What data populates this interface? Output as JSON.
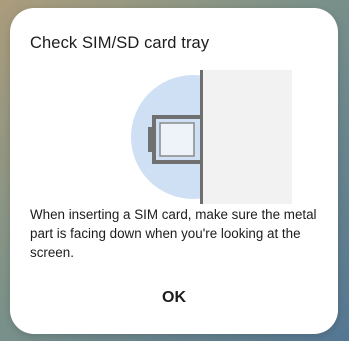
{
  "dialog": {
    "title": "Check SIM/SD card tray",
    "message": "When inserting a SIM card, make sure the metal part is facing down when you're looking at the screen.",
    "ok_label": "OK"
  },
  "illustration": {
    "icon": "sim-tray-insertion-icon"
  },
  "colors": {
    "dialog_bg": "#ffffff",
    "circle": "#cfe0f5",
    "phone_body": "#f2f2f2",
    "phone_edge": "#6e6e6e",
    "tray_frame": "#707070",
    "text": "#1c1c1c"
  }
}
